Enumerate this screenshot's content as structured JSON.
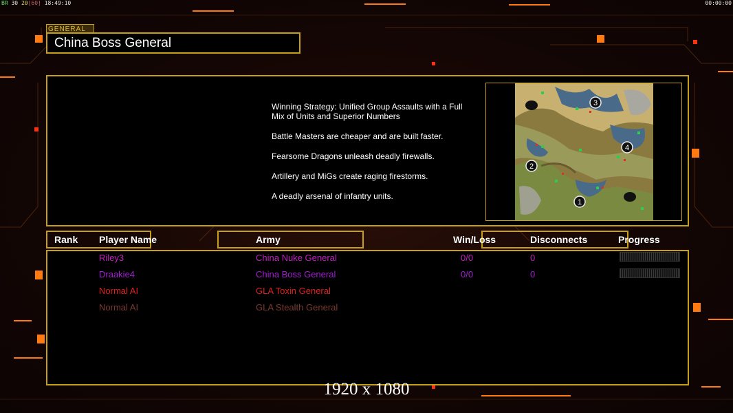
{
  "hud": {
    "fps_label": "BR",
    "fps_value": "30",
    "fps_target": "20",
    "fps_limit": "[60]",
    "clock": "18:49:10",
    "timer": "00:00:00"
  },
  "header": {
    "tag": "GENERAL",
    "title": "China Boss General"
  },
  "description": [
    "Winning Strategy: Unified Group Assaults with a Full\n Mix of Units and Superior Numbers",
    "Battle Masters are cheaper and are built faster.",
    "Fearsome Dragons unleash deadly firewalls.",
    "Artillery and MiGs create raging firestorms.",
    "A deadly arsenal of infantry units."
  ],
  "minimap": {
    "start_positions": [
      "1",
      "2",
      "3",
      "4"
    ]
  },
  "table": {
    "headers": {
      "rank": "Rank",
      "player_name": "Player Name",
      "army": "Army",
      "win_loss": "Win/Loss",
      "disconnects": "Disconnects",
      "progress": "Progress"
    },
    "rows": [
      {
        "name": "Riley3",
        "army": "China Nuke General",
        "win_loss": "0/0",
        "disconnects": "0",
        "color": "#c020c0",
        "show_progress": true
      },
      {
        "name": "Draakie4",
        "army": "China Boss General",
        "win_loss": "0/0",
        "disconnects": "0",
        "color": "#a020d0",
        "show_progress": true
      },
      {
        "name": "Normal AI",
        "army": "GLA Toxin General",
        "win_loss": "",
        "disconnects": "",
        "color": "#e02020",
        "show_progress": false
      },
      {
        "name": "Normal AI",
        "army": "GLA Stealth General",
        "win_loss": "",
        "disconnects": "",
        "color": "#7a3a30",
        "show_progress": false
      }
    ]
  },
  "resolution": "1920 x 1080",
  "colors": {
    "frame": "#c8a018",
    "accent_orange": "#ff7a10"
  }
}
